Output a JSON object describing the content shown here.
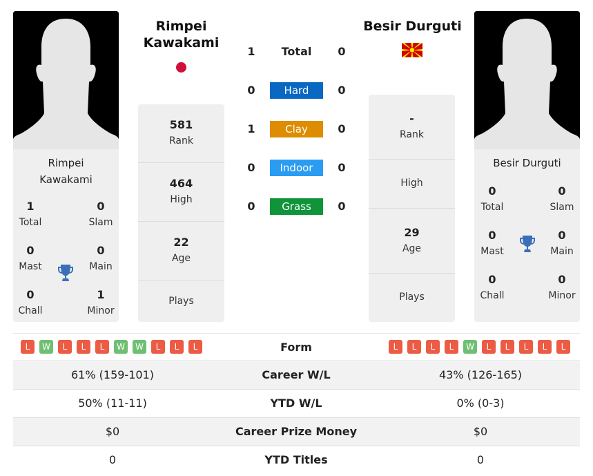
{
  "player1": {
    "name": "Rimpei Kawakami",
    "name_line1": "Rimpei",
    "name_line2": "Kawakami",
    "country_flag": "Japan",
    "titles": {
      "total": {
        "value": "1",
        "label": "Total"
      },
      "slam": {
        "value": "0",
        "label": "Slam"
      },
      "mast": {
        "value": "0",
        "label": "Mast"
      },
      "main": {
        "value": "0",
        "label": "Main"
      },
      "chall": {
        "value": "0",
        "label": "Chall"
      },
      "minor": {
        "value": "1",
        "label": "Minor"
      }
    },
    "stats": {
      "rank": {
        "value": "581",
        "label": "Rank"
      },
      "high": {
        "value": "464",
        "label": "High"
      },
      "age": {
        "value": "22",
        "label": "Age"
      },
      "plays": {
        "value": "",
        "label": "Plays"
      }
    },
    "form": [
      "L",
      "W",
      "L",
      "L",
      "L",
      "W",
      "W",
      "L",
      "L",
      "L"
    ]
  },
  "player2": {
    "name": "Besir Durguti",
    "country_flag": "North Macedonia",
    "titles": {
      "total": {
        "value": "0",
        "label": "Total"
      },
      "slam": {
        "value": "0",
        "label": "Slam"
      },
      "mast": {
        "value": "0",
        "label": "Mast"
      },
      "main": {
        "value": "0",
        "label": "Main"
      },
      "chall": {
        "value": "0",
        "label": "Chall"
      },
      "minor": {
        "value": "0",
        "label": "Minor"
      }
    },
    "stats": {
      "rank": {
        "value": "-",
        "label": "Rank"
      },
      "high": {
        "value": "",
        "label": "High"
      },
      "age": {
        "value": "29",
        "label": "Age"
      },
      "plays": {
        "value": "",
        "label": "Plays"
      }
    },
    "form": [
      "L",
      "L",
      "L",
      "L",
      "W",
      "L",
      "L",
      "L",
      "L",
      "L"
    ]
  },
  "h2h": {
    "total": {
      "label": "Total",
      "p1": "1",
      "p2": "0"
    },
    "surfaces": [
      {
        "label": "Hard",
        "p1": "0",
        "p2": "0",
        "color": "#0868c2"
      },
      {
        "label": "Clay",
        "p1": "1",
        "p2": "0",
        "color": "#de8c00"
      },
      {
        "label": "Indoor",
        "p1": "0",
        "p2": "0",
        "color": "#2a9cf2"
      },
      {
        "label": "Grass",
        "p1": "0",
        "p2": "0",
        "color": "#0f9439"
      }
    ]
  },
  "form_label": "Form",
  "comparison": [
    {
      "label": "Career W/L",
      "p1": "61% (159-101)",
      "p2": "43% (126-165)"
    },
    {
      "label": "YTD W/L",
      "p1": "50% (11-11)",
      "p2": "0% (0-3)"
    },
    {
      "label": "Career Prize Money",
      "p1": "$0",
      "p2": "$0"
    },
    {
      "label": "YTD Titles",
      "p1": "0",
      "p2": "0"
    }
  ],
  "colors": {
    "loss": "#ec5b44",
    "win": "#6fbf73",
    "trophy": "#3a6fb8"
  }
}
